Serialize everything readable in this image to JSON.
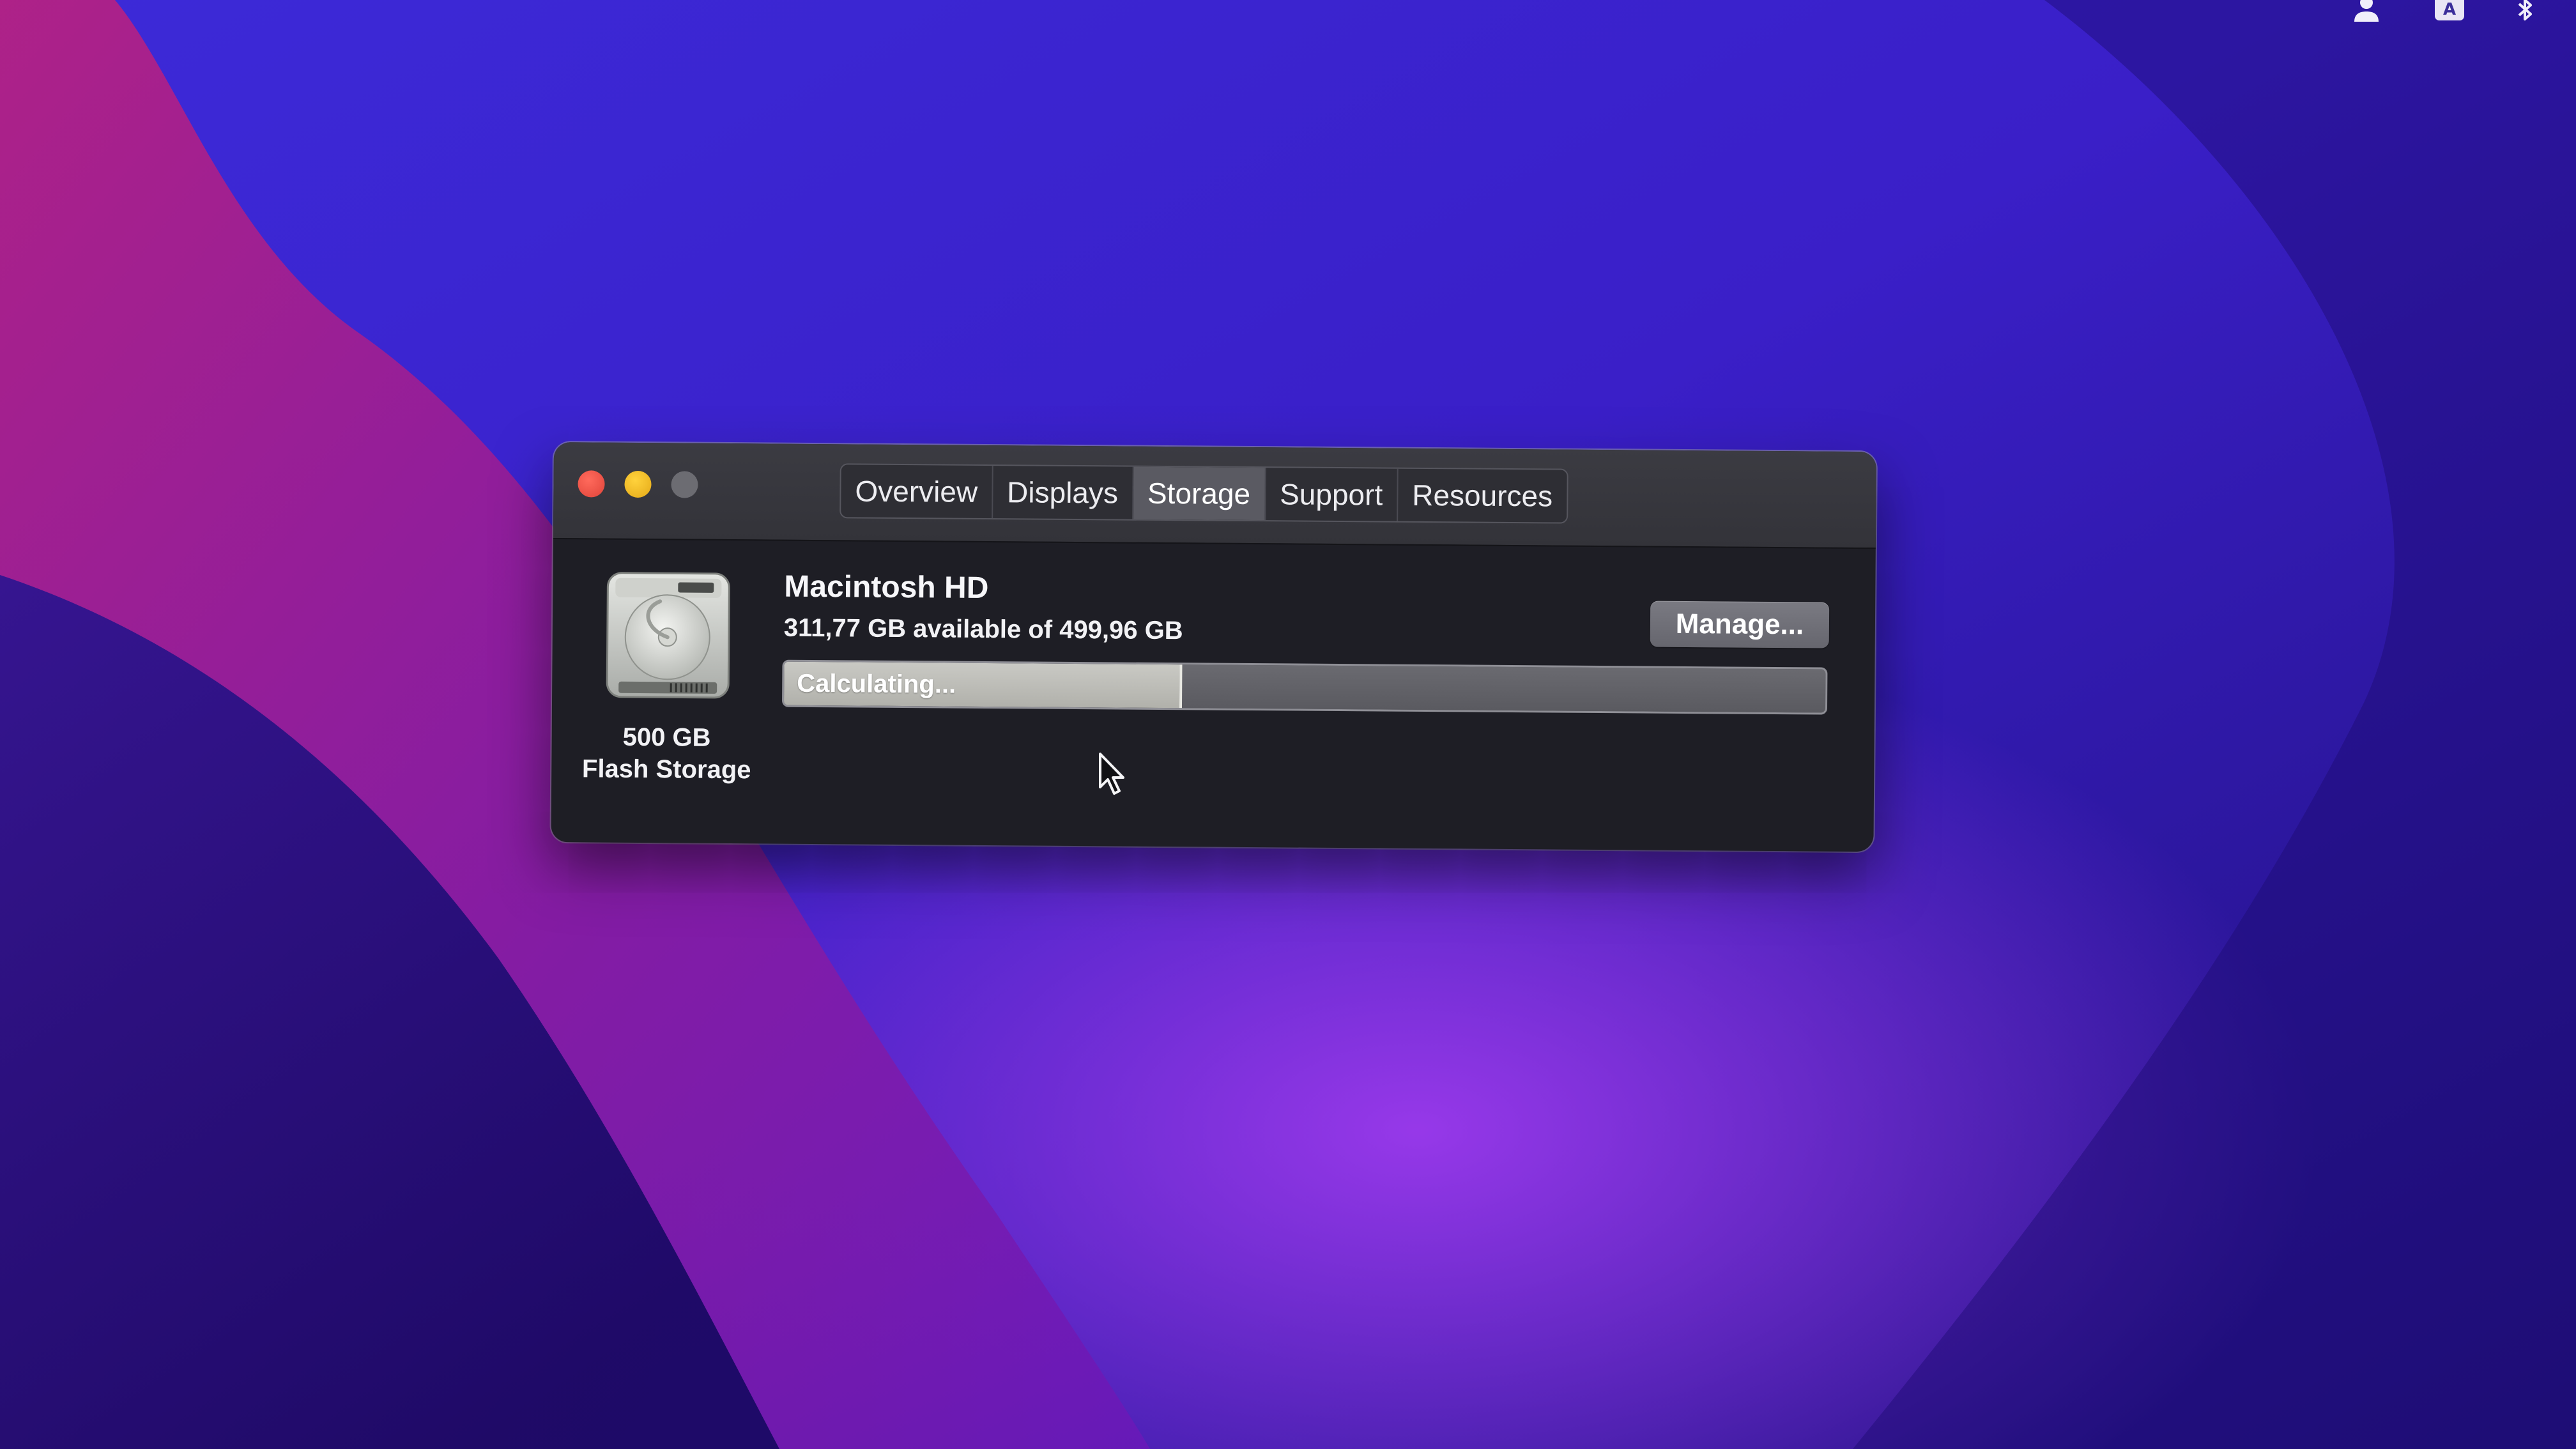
{
  "window": {
    "tabs": [
      {
        "label": "Overview"
      },
      {
        "label": "Displays"
      },
      {
        "label": "Storage",
        "selected": true
      },
      {
        "label": "Support"
      },
      {
        "label": "Resources"
      }
    ]
  },
  "disk": {
    "capacity": "500 GB",
    "type": "Flash Storage",
    "icon": "hard-drive-icon"
  },
  "volume": {
    "name": "Macintosh HD",
    "available_text": "311,77 GB available of 499,96 GB",
    "manage_label": "Manage...",
    "bar_status": "Calculating...",
    "bar_fill_fraction": 0.38
  },
  "menubar": {
    "icons": [
      "user-icon",
      "input-source-icon",
      "bluetooth-icon"
    ],
    "input_source_letter": "A"
  },
  "colors": {
    "close": "#ff5f57",
    "minimize": "#febc2e",
    "zoom_inactive": "#6c6c72",
    "window_bg": "#1e1e25"
  }
}
